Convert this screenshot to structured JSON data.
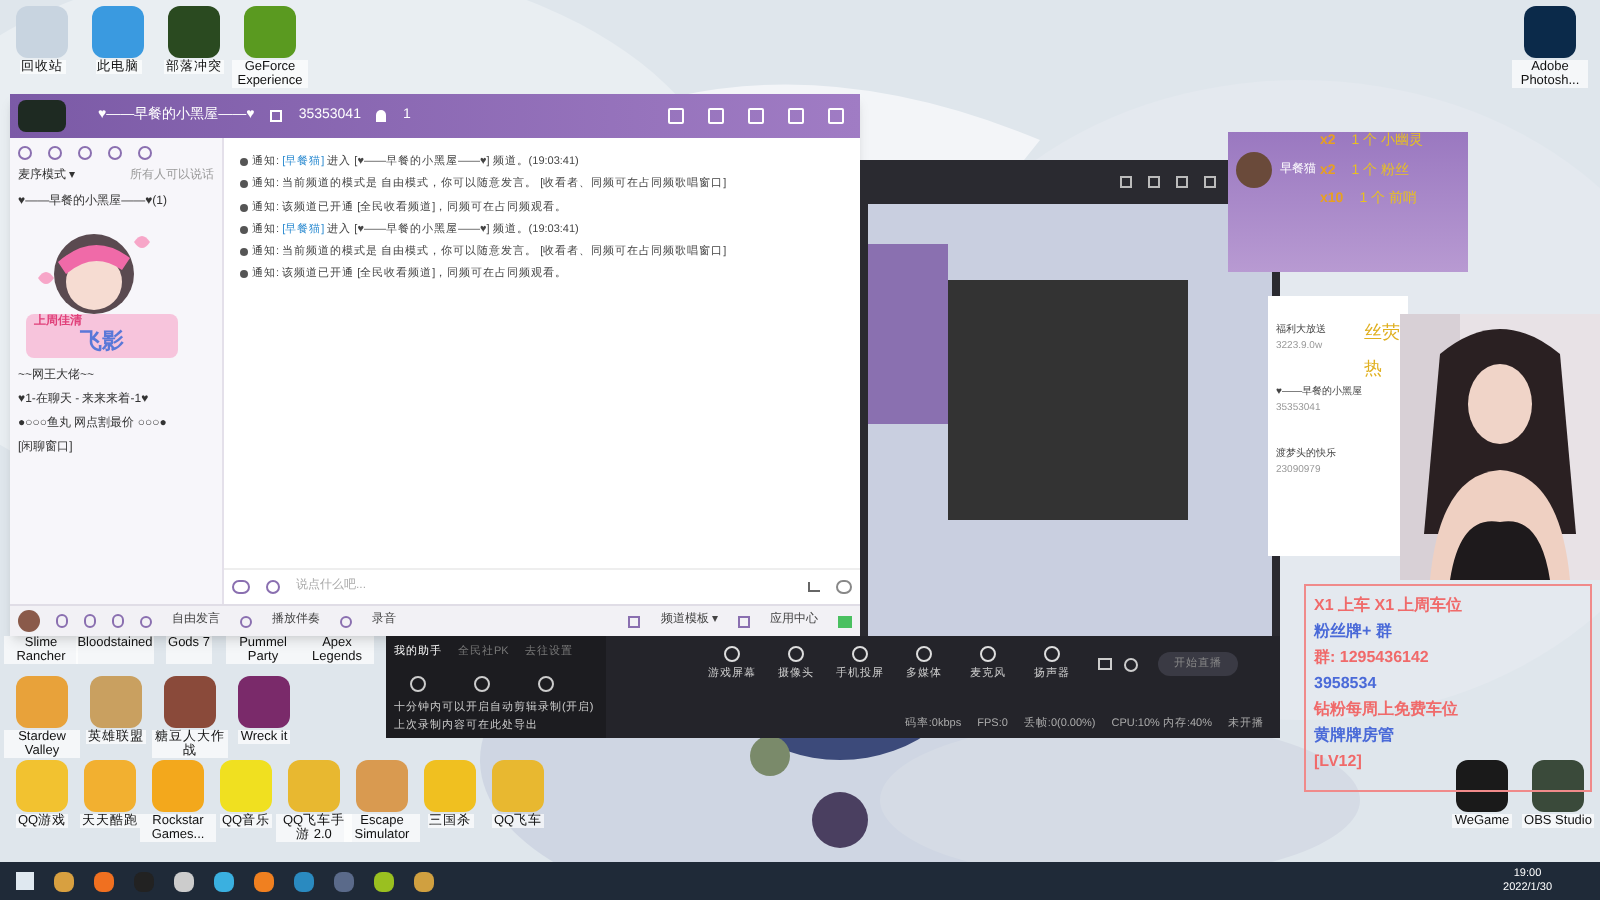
{
  "desktop_top_icons": [
    {
      "label": "回收站",
      "kind": "bin"
    },
    {
      "label": "此电脑",
      "kind": "pc"
    },
    {
      "label": "部落冲突",
      "kind": "game"
    },
    {
      "label": "GeForce Experience",
      "kind": "nvidia"
    }
  ],
  "desktop_right_icon": {
    "label": "Adobe Photosh..."
  },
  "chat_window": {
    "title": "♥——早餐的小黑屋——♥",
    "channel_id": "35353041",
    "online": "1",
    "sidebar_mode": "麦序模式 ▾",
    "sidebar_hint": "所有人可以说话",
    "channels": [
      {
        "label": "♥——早餐的小黑屋——♥(1)",
        "selected": false
      },
      {
        "label": "~~网王大佬~~",
        "selected": false
      },
      {
        "label": "♥1-在聊天 - 来来来着-1♥",
        "selected": false
      },
      {
        "label": "●○○○鱼丸 网点割最价 ○○○●",
        "selected": false
      },
      {
        "label": "[闲聊窗口]",
        "selected": false
      }
    ],
    "sticker": {
      "caption": "上周佳清",
      "name": "飞影"
    },
    "messages": [
      {
        "prefix": "通知:",
        "user": "[早餐猫]",
        "text": "进入 [♥——早餐的小黑屋——♥] 频道。(19:03:41)"
      },
      {
        "prefix": "通知:",
        "text": "当前频道的模式是 自由模式，你可以随意发言。 [收看者、同频可在占同频歌唱窗口]"
      },
      {
        "prefix": "通知:",
        "text": "该频道已开通 [全民收看频道]，同频可在占同频观看。"
      },
      {
        "prefix": "通知:",
        "user": "[早餐猫]",
        "text": "进入 [♥——早餐的小黑屋——♥] 频道。(19:03:41)"
      },
      {
        "prefix": "通知:",
        "text": "当前频道的模式是 自由模式，你可以随意发言。 [收看者、同频可在占同频歌唱窗口]"
      },
      {
        "prefix": "通知:",
        "text": "该频道已开通 [全民收看频道]，同频可在占同频观看。"
      }
    ],
    "input": {
      "placeholder": "说点什么吧..."
    },
    "bottom_left": [
      "自由发言",
      "播放伴奏",
      "录音"
    ],
    "bottom_right": [
      "频道模板 ▾",
      "应用中心"
    ]
  },
  "stream_toolbar": {
    "tabs": [
      {
        "label": "我的助手",
        "selected": true
      },
      {
        "label": "全民社PK",
        "selected": false
      },
      {
        "label": "去往设置",
        "selected": false
      }
    ],
    "notice": "十分钟内可以开启自动剪辑录制(开启)",
    "notice2": "上次录制内容可在此处导出",
    "sources": [
      "游戏屏幕",
      "摄像头",
      "手机投屏",
      "多媒体",
      "麦克风",
      "扬声器"
    ],
    "start": "开始直播",
    "status": [
      "码率:0kbps",
      "FPS:0",
      "丢帧:0(0.00%)",
      "CPU:10%  内存:40%",
      "未开播"
    ]
  },
  "desktop_rows": [
    [
      {
        "label": "Slime Rancher"
      },
      {
        "label": "Bloodstained"
      },
      {
        "label": "Gods 7"
      },
      {
        "label": "Pummel Party"
      },
      {
        "label": "Apex Legends"
      }
    ],
    [
      {
        "label": "Stardew Valley",
        "color": "#e8a23a"
      },
      {
        "label": "英雄联盟",
        "color": "#c9a060"
      },
      {
        "label": "糖豆人大作战",
        "color": "#8a4a3a"
      },
      {
        "label": "Wreck it",
        "color": "#7a2a6a"
      }
    ],
    [
      {
        "label": "QQ游戏",
        "color": "#f2c230"
      },
      {
        "label": "天天酷跑",
        "color": "#f2b030"
      },
      {
        "label": "Rockstar Games...",
        "color": "#f3a81c"
      },
      {
        "label": "QQ音乐",
        "color": "#f0e020"
      },
      {
        "label": "QQ飞车手游 2.0",
        "color": "#e8b830"
      },
      {
        "label": "Escape Simulator",
        "color": "#d99a50"
      },
      {
        "label": "三国杀",
        "color": "#f0c020"
      },
      {
        "label": "QQ飞车",
        "color": "#e8b830"
      }
    ]
  ],
  "overlay": {
    "profile_name": "早餐猫",
    "gifts": [
      "1 个 小幽灵",
      "1 个 粉丝",
      "1 个 前哨"
    ],
    "counts": [
      "x2",
      "x2",
      "x10"
    ],
    "side_text": [
      "丝荧",
      "热"
    ],
    "list": [
      {
        "name": "福利大放送",
        "id": "3223.9.0w"
      },
      {
        "name": "♥——早餐的小黑屋",
        "id": "35353041"
      },
      {
        "name": "渡梦头的快乐",
        "id": "23090979"
      }
    ],
    "promo": [
      "X1 上车 X1 上周车位",
      "粉丝牌+ 群",
      "群: 1295436142",
      "3958534",
      "钻粉每周上免费车位",
      "黄牌牌房管",
      "[LV12]"
    ]
  },
  "desktop_bottom_right": [
    {
      "label": "WeGame"
    },
    {
      "label": "OBS Studio"
    }
  ],
  "taskbar": {
    "time": "19:00",
    "date": "2022/1/30"
  }
}
